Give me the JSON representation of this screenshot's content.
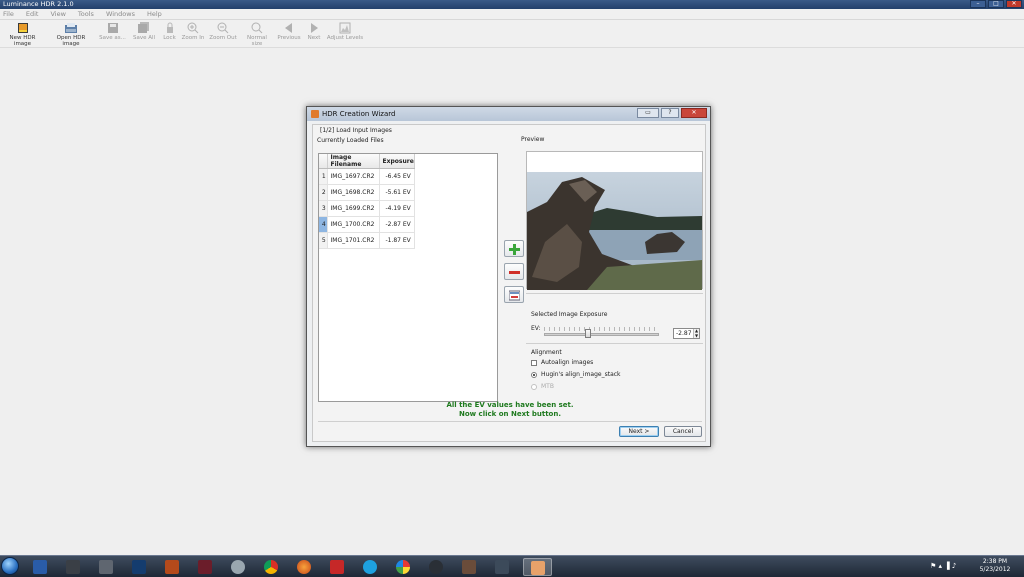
{
  "app": {
    "title": "Luminance HDR 2.1.0"
  },
  "menu": [
    "File",
    "Edit",
    "View",
    "Tools",
    "Windows",
    "Help"
  ],
  "toolbar": [
    {
      "label": "New HDR image",
      "enabled": true,
      "icon": "new-hdr-icon"
    },
    {
      "label": "Open HDR image",
      "enabled": true,
      "icon": "open-hdr-icon"
    },
    {
      "label": "Save as...",
      "enabled": false,
      "icon": "save-as-icon"
    },
    {
      "label": "Save All",
      "enabled": false,
      "icon": "save-all-icon"
    },
    {
      "label": "Lock",
      "enabled": false,
      "icon": "lock-icon"
    },
    {
      "label": "Zoom In",
      "enabled": false,
      "icon": "zoom-in-icon"
    },
    {
      "label": "Zoom Out",
      "enabled": false,
      "icon": "zoom-out-icon"
    },
    {
      "label": "Normal size",
      "enabled": false,
      "icon": "normal-size-icon"
    },
    {
      "label": "Previous",
      "enabled": false,
      "icon": "previous-icon"
    },
    {
      "label": "Next",
      "enabled": false,
      "icon": "next-icon"
    },
    {
      "label": "Adjust Levels",
      "enabled": false,
      "icon": "adjust-levels-icon"
    }
  ],
  "dialog": {
    "title": "HDR Creation Wizard",
    "step": "[1/2] Load Input Images",
    "files_label": "Currently Loaded Files",
    "preview_label": "Preview",
    "table": {
      "headers": [
        "Image Filename",
        "Exposure"
      ],
      "rows": [
        {
          "index": "1",
          "filename": "IMG_1697.CR2",
          "exposure": "-6.45 EV"
        },
        {
          "index": "2",
          "filename": "IMG_1698.CR2",
          "exposure": "-5.61 EV"
        },
        {
          "index": "3",
          "filename": "IMG_1699.CR2",
          "exposure": "-4.19 EV"
        },
        {
          "index": "4",
          "filename": "IMG_1700.CR2",
          "exposure": "-2.87 EV"
        },
        {
          "index": "5",
          "filename": "IMG_1701.CR2",
          "exposure": "-1.87 EV"
        }
      ],
      "selected_index": "4"
    },
    "exposure": {
      "group_label": "Selected Image Exposure",
      "ev_label": "EV:",
      "value": "-2.87"
    },
    "alignment": {
      "group_label": "Alignment",
      "autoalign_label": "Autoalign images",
      "hugin_label": "Hugin's align_image_stack",
      "mtb_label": "MTB"
    },
    "status_line1": "All the EV values have been set.",
    "status_line2": "Now click on Next button.",
    "next_label": "Next >",
    "cancel_label": "Cancel"
  },
  "taskbar": {
    "time": "2:38 PM",
    "date": "5/23/2012"
  }
}
